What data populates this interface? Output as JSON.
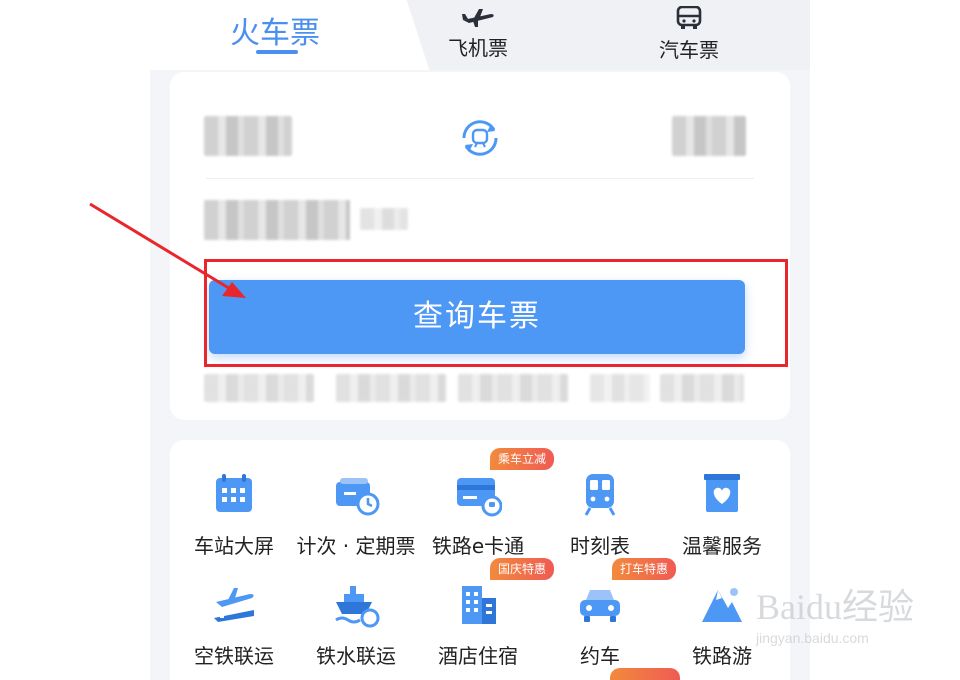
{
  "tabs": {
    "train": "火车票",
    "plane": "飞机票",
    "bus": "汽车票"
  },
  "query_button": "查询车票",
  "services": [
    {
      "label": "车站大屏",
      "icon": "calendar-screen-icon",
      "badge": ""
    },
    {
      "label": "计次 · 定期票",
      "icon": "ticket-clock-icon",
      "badge": ""
    },
    {
      "label": "铁路e卡通",
      "icon": "rail-card-icon",
      "badge": "乘车立减"
    },
    {
      "label": "时刻表",
      "icon": "train-front-icon",
      "badge": ""
    },
    {
      "label": "温馨服务",
      "icon": "heart-box-icon",
      "badge": ""
    },
    {
      "label": "空铁联运",
      "icon": "plane-train-icon",
      "badge": ""
    },
    {
      "label": "铁水联运",
      "icon": "ship-train-icon",
      "badge": ""
    },
    {
      "label": "酒店住宿",
      "icon": "hotel-building-icon",
      "badge": "国庆特惠"
    },
    {
      "label": "约车",
      "icon": "car-icon",
      "badge": "打车特惠"
    },
    {
      "label": "铁路游",
      "icon": "mountain-icon",
      "badge": ""
    }
  ],
  "watermark": {
    "brand": "Baidu经验",
    "url": "jingyan.baidu.com"
  },
  "colors": {
    "accent": "#4d97f5",
    "highlight": "#e8262b",
    "badge": "#ef5b54"
  }
}
